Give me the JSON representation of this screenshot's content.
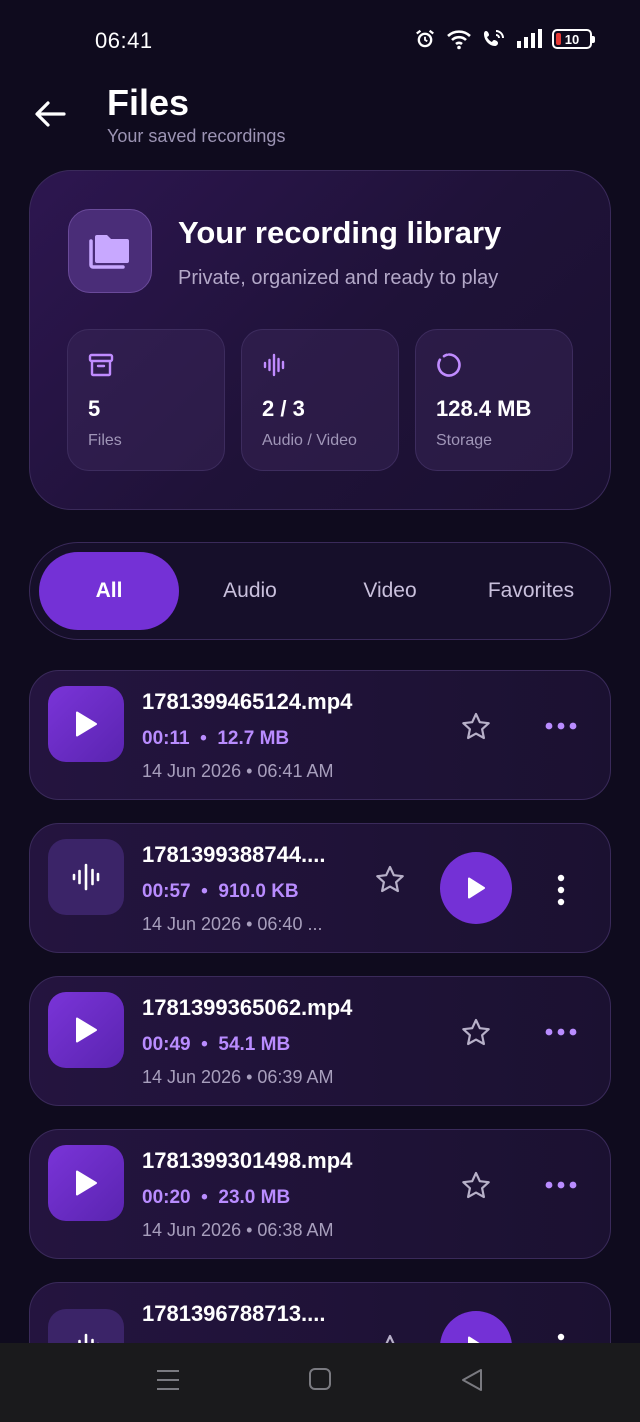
{
  "status": {
    "time": "06:41",
    "battery": "10"
  },
  "header": {
    "title": "Files",
    "subtitle": "Your saved recordings"
  },
  "library": {
    "title": "Your recording library",
    "subtitle": "Private, organized and ready to play",
    "stats": [
      {
        "value": "5",
        "label": "Files",
        "icon": "archive-icon"
      },
      {
        "value": "2 / 3",
        "label": "Audio / Video",
        "icon": "waveform-icon"
      },
      {
        "value": "128.4 MB",
        "label": "Storage",
        "icon": "storage-ring-icon"
      }
    ]
  },
  "tabs": [
    {
      "label": "All",
      "active": true
    },
    {
      "label": "Audio",
      "active": false
    },
    {
      "label": "Video",
      "active": false
    },
    {
      "label": "Favorites",
      "active": false
    }
  ],
  "files": [
    {
      "name": "1781399465124.mp4",
      "duration": "00:11",
      "size": "12.7 MB",
      "date": "14 Jun 2026",
      "time": "06:41 AM",
      "type": "video"
    },
    {
      "name": "1781399388744....",
      "duration": "00:57",
      "size": "910.0 KB",
      "date": "14 Jun 2026",
      "time": "06:40 ...",
      "type": "audio"
    },
    {
      "name": "1781399365062.mp4",
      "duration": "00:49",
      "size": "54.1 MB",
      "date": "14 Jun 2026",
      "time": "06:39 AM",
      "type": "video"
    },
    {
      "name": "1781399301498.mp4",
      "duration": "00:20",
      "size": "23.0 MB",
      "date": "14 Jun 2026",
      "time": "06:38 AM",
      "type": "video"
    },
    {
      "name": "1781396788713....",
      "duration": "",
      "size": "",
      "date": "",
      "time": "",
      "type": "audio"
    }
  ],
  "colors": {
    "accent": "#7431d6",
    "meta": "#b98cff",
    "background": "#0f0b1e"
  }
}
